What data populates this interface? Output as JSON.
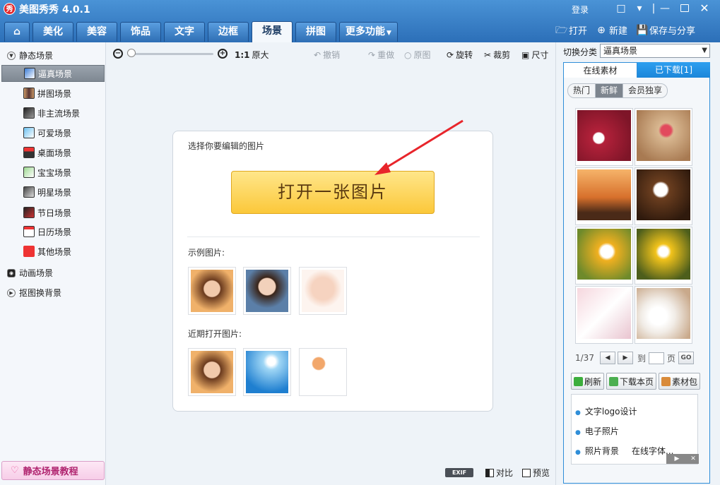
{
  "app": {
    "title": "美图秀秀 4.0.1",
    "logo_char": "秀",
    "login": "登录"
  },
  "nav": {
    "tabs": [
      "美化",
      "美容",
      "饰品",
      "文字",
      "边框",
      "场景",
      "拼图"
    ],
    "active_tab": "场景",
    "more": "更多功能"
  },
  "actions": {
    "open": "打开",
    "new": "新建",
    "save_share": "保存与分享"
  },
  "sidebar": {
    "group_static": "静态场景",
    "items": [
      "逼真场景",
      "拼图场景",
      "非主流场景",
      "可爱场景",
      "桌面场景",
      "宝宝场景",
      "明星场景",
      "节日场景",
      "日历场景",
      "其他场景"
    ],
    "active_item": "逼真场景",
    "group_animated": "动画场景",
    "group_cutout": "抠图换背景",
    "tutorial": "静态场景教程"
  },
  "toolbar": {
    "ratio": "1:1",
    "original_size": "原大",
    "undo": "撤销",
    "redo": "重做",
    "original": "原图",
    "rotate": "旋转",
    "crop": "裁剪",
    "resize": "尺寸"
  },
  "card": {
    "prompt": "选择你要编辑的图片",
    "open_button": "打开一张图片",
    "examples_label": "示例图片:",
    "recent_label": "近期打开图片:"
  },
  "bottom": {
    "exif": "EXIF",
    "compare": "对比",
    "preview": "预览"
  },
  "right_panel": {
    "category_label": "切换分类",
    "category_value": "逼真场景",
    "tab_online": "在线素材",
    "tab_downloaded": "已下载[1]",
    "chips": [
      "热门",
      "新鲜",
      "会员独享"
    ],
    "active_chip": "新鲜",
    "page": "1/37",
    "goto_label": "到",
    "page_suffix": "页",
    "go": "GO",
    "refresh": "刷新",
    "download_page": "下载本页",
    "package": "素材包",
    "links": [
      "文字logo设计",
      "电子照片",
      "照片背景",
      "在线字体..."
    ]
  },
  "colors": {
    "titlebar": "#2c6fb8",
    "accent_yellow": "#fbc83a",
    "arrow_red": "#e8252b",
    "panel_blue": "#2f8ed8"
  }
}
